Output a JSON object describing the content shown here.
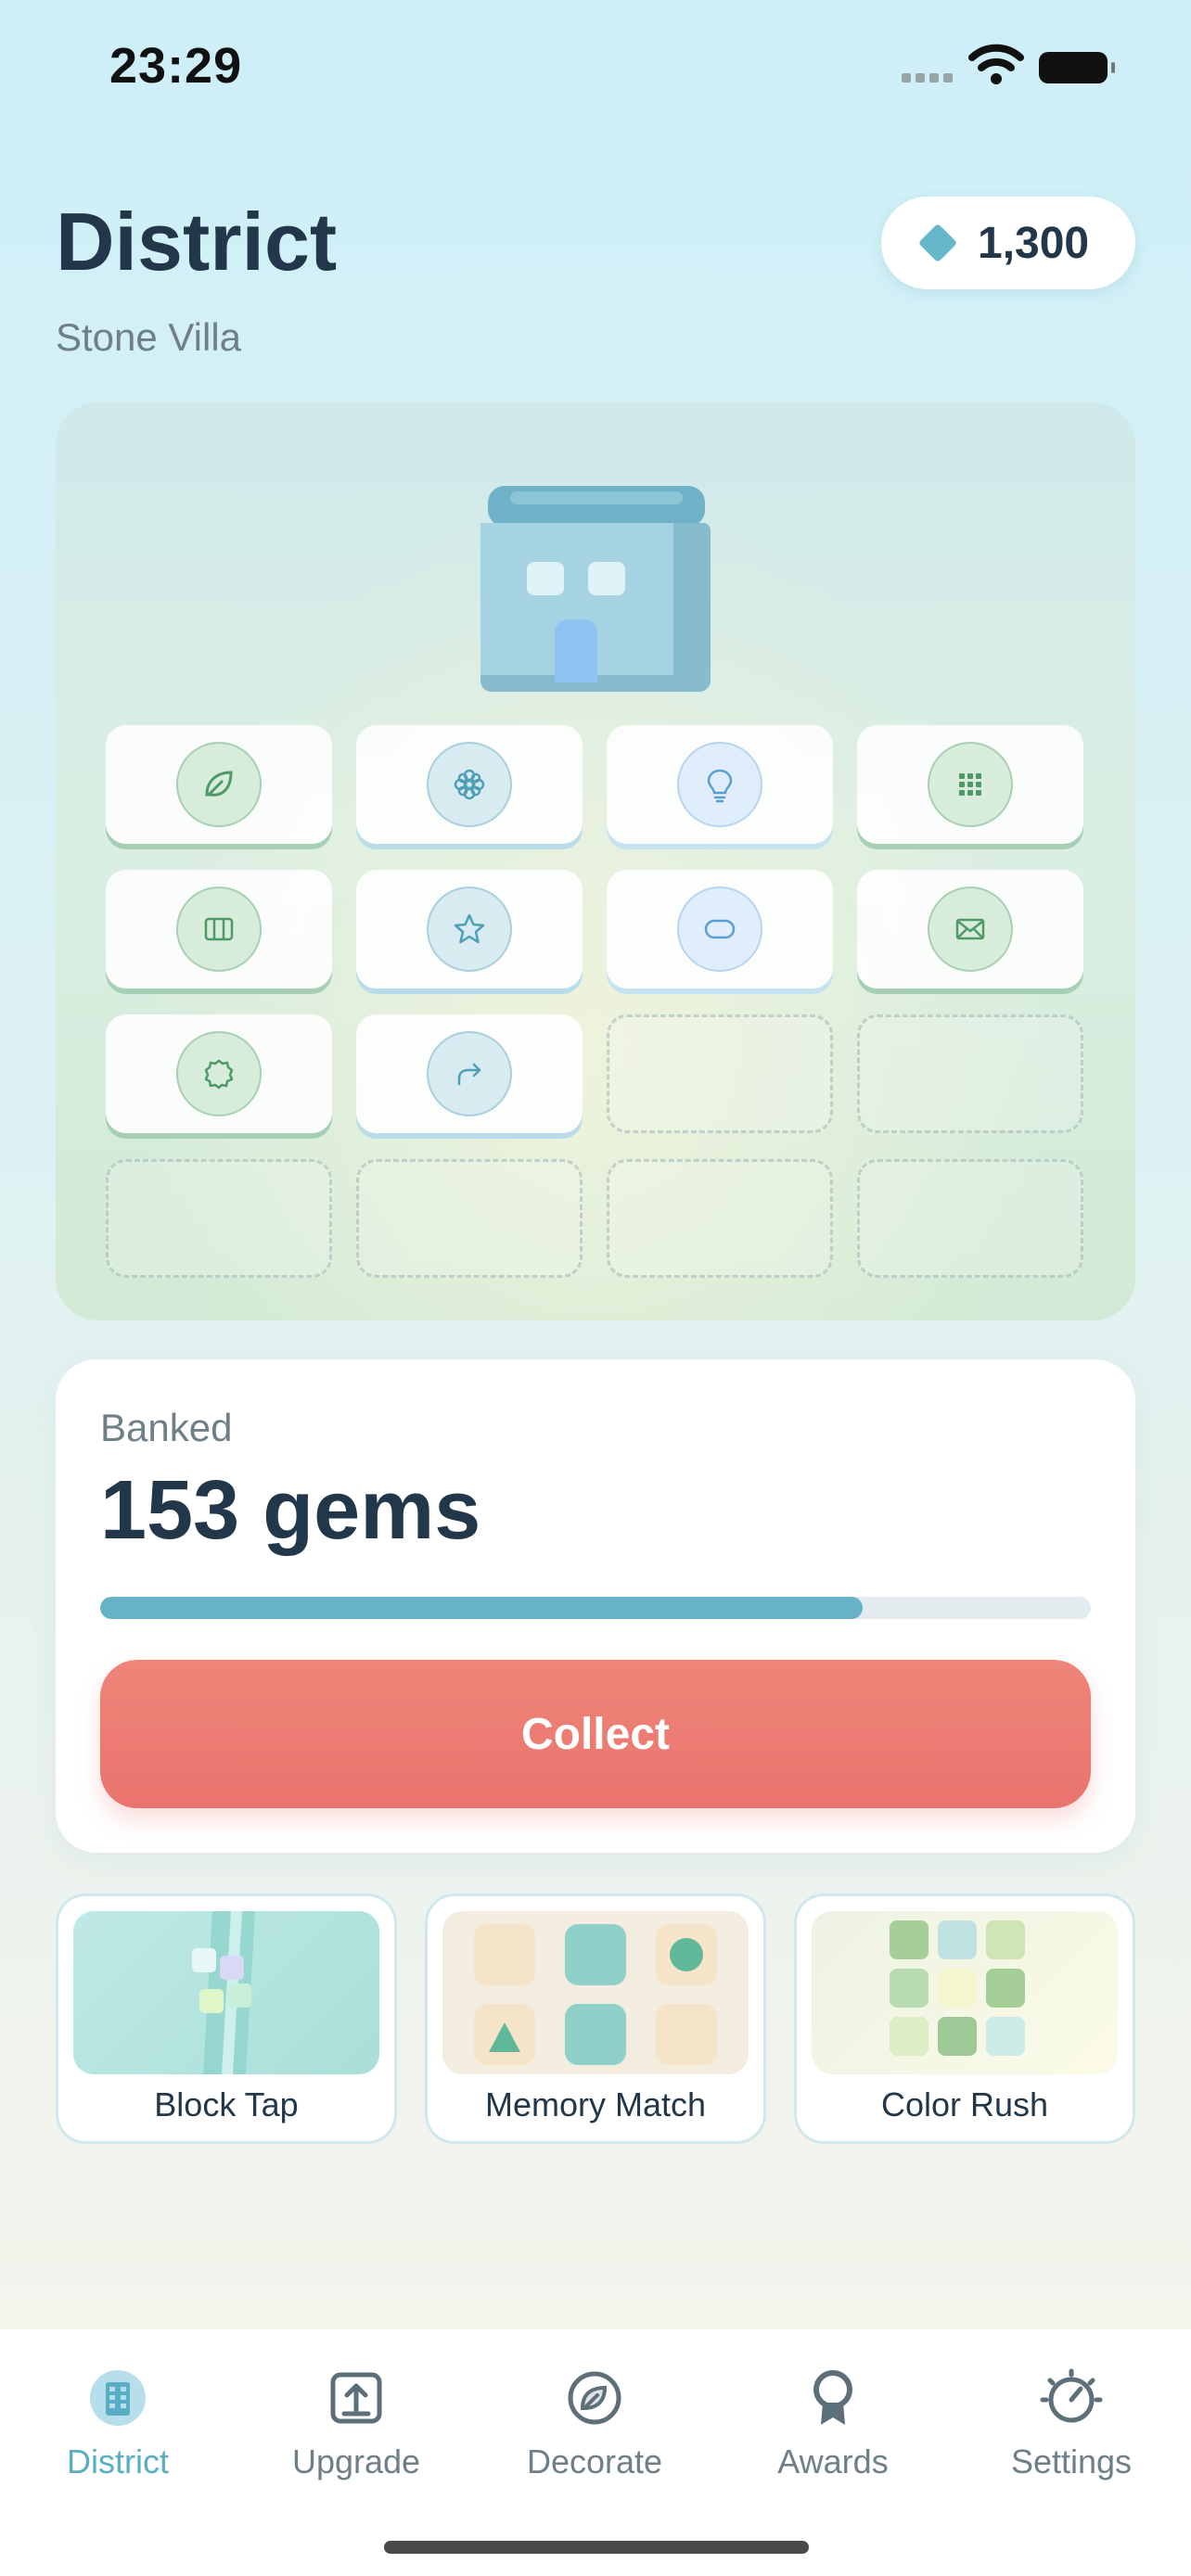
{
  "status_bar": {
    "time": "23:29"
  },
  "header": {
    "title": "District",
    "subtitle": "Stone Villa",
    "gems": "1,300"
  },
  "grid": {
    "tiles": [
      {
        "icon": "leaf-icon",
        "style": "green"
      },
      {
        "icon": "flower-icon",
        "style": "blue"
      },
      {
        "icon": "lightbulb-icon",
        "style": "lite"
      },
      {
        "icon": "grid-dots-icon",
        "style": "green"
      },
      {
        "icon": "columns-icon",
        "style": "green"
      },
      {
        "icon": "star-icon",
        "style": "blue"
      },
      {
        "icon": "capsule-icon",
        "style": "lite"
      },
      {
        "icon": "envelope-icon",
        "style": "green"
      },
      {
        "icon": "badge-icon",
        "style": "green"
      },
      {
        "icon": "share-arrow-icon",
        "style": "blue"
      }
    ],
    "empty_slots": 6
  },
  "bank": {
    "label": "Banked",
    "value": "153 gems",
    "progress_fraction": 0.77,
    "collect_label": "Collect"
  },
  "games": [
    {
      "label": "Block Tap"
    },
    {
      "label": "Memory Match"
    },
    {
      "label": "Color Rush"
    }
  ],
  "nav": [
    {
      "label": "District",
      "icon": "building-icon",
      "active": true
    },
    {
      "label": "Upgrade",
      "icon": "upgrade-arrow-icon",
      "active": false
    },
    {
      "label": "Decorate",
      "icon": "decorate-leaf-icon",
      "active": false
    },
    {
      "label": "Awards",
      "icon": "ribbon-icon",
      "active": false
    },
    {
      "label": "Settings",
      "icon": "gauge-settings-icon",
      "active": false
    }
  ],
  "colors": {
    "accent": "#66b3c7",
    "collect": "#ec7c72",
    "title": "#22384a"
  }
}
